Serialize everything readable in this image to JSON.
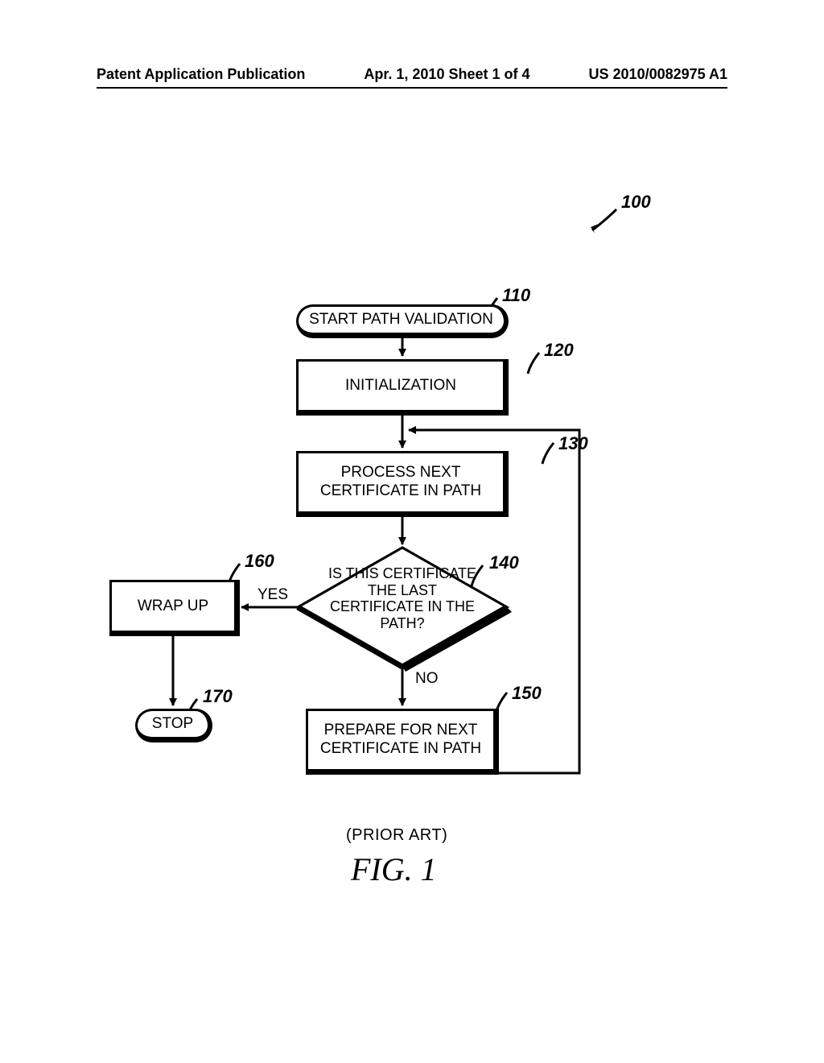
{
  "header": {
    "left": "Patent Application Publication",
    "center": "Apr. 1, 2010  Sheet 1 of 4",
    "right": "US 2010/0082975 A1"
  },
  "refs": {
    "r100": "100",
    "r110": "110",
    "r120": "120",
    "r130": "130",
    "r140": "140",
    "r150": "150",
    "r160": "160",
    "r170": "170"
  },
  "nodes": {
    "start": "START PATH VALIDATION",
    "init": "INITIALIZATION",
    "process": "PROCESS NEXT CERTIFICATE IN PATH",
    "decision": "IS THIS CERTIFICATE THE LAST CERTIFICATE IN THE PATH?",
    "prepare": "PREPARE FOR NEXT CERTIFICATE IN PATH",
    "wrapup": "WRAP UP",
    "stop": "STOP"
  },
  "edges": {
    "yes": "YES",
    "no": "NO"
  },
  "footer": {
    "prior_art": "(PRIOR ART)",
    "fig": "FIG. 1"
  }
}
